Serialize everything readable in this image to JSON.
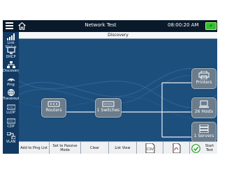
{
  "topbar": {
    "title": "Network Test",
    "time": "08:00:20 AM"
  },
  "sidebar": {
    "items": [
      {
        "label": "Link Status"
      },
      {
        "label": "DHCP"
      },
      {
        "label": "Discovery"
      },
      {
        "label": "Ping"
      },
      {
        "label": "Traceroute"
      },
      {
        "label": "LLDP"
      },
      {
        "label": "CDP"
      },
      {
        "label": "VLAN"
      }
    ]
  },
  "main": {
    "header": "Discovery",
    "nodes": {
      "routers": "Routers",
      "switches": "1 Switches",
      "printers": "Printers",
      "hosts": "26 Hosts",
      "servers": "1 Servers"
    }
  },
  "toolbar": {
    "add_to_ping": "Add to Ping List",
    "set_passive": "Set to Passive Mode",
    "clear": "Clear",
    "list_view": "List View",
    "csv": "CSV",
    "start_test": "Start Test"
  },
  "colors": {
    "background": "#1d4f7d",
    "sidebar": "#123a63",
    "accent": "#30c030"
  }
}
